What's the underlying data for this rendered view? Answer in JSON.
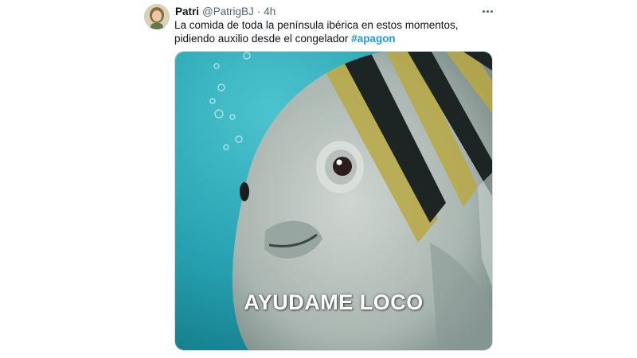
{
  "tweet": {
    "display_name": "Patri",
    "handle": "@PatrigBJ",
    "separator": "·",
    "time": "4h",
    "text": "La comida de toda la península ibérica en estos momentos, pidiendo auxilio desde el congelador ",
    "hashtag": "#apagon",
    "more_icon": "more-horizontal-icon",
    "media": {
      "caption": "AYUDAME LOCO",
      "background_color": "#2fa9b8"
    },
    "colors": {
      "link": "#1d9bf0",
      "text": "#0f1419",
      "secondary": "#536471"
    }
  }
}
